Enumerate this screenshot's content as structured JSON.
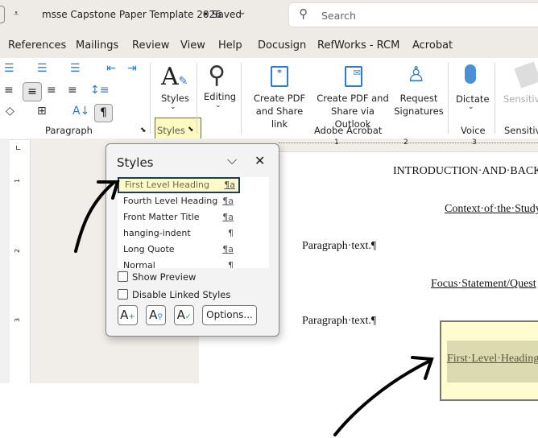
{
  "titlebar": {
    "customize_icon": "quick-access-dropdown",
    "document_title": "msse Capstone Paper  Template 2026",
    "status": "• Saved",
    "search_placeholder": "Search"
  },
  "tabs": [
    "References",
    "Mailings",
    "Review",
    "View",
    "Help",
    "Docusign",
    "RefWorks - RCM",
    "Acrobat"
  ],
  "ribbon": {
    "paragraph_group": "Paragraph",
    "styles_button": "Styles",
    "styles_group": "Styles",
    "editing_button": "Editing",
    "acrobat": {
      "create_share_link": [
        "Create PDF",
        "and Share link"
      ],
      "create_outlook": [
        "Create PDF and",
        "Share via Outlook"
      ],
      "request_signatures": [
        "Request",
        "Signatures"
      ],
      "group": "Adobe Acrobat"
    },
    "voice": {
      "dictate": "Dictate",
      "group": "Voice"
    },
    "sensitivity": {
      "button": "Sensitivi",
      "group": "Sensitivi"
    }
  },
  "styles_pane": {
    "title": "Styles",
    "items": [
      {
        "name": "First Level Heading",
        "mark": "¶a",
        "selected": true
      },
      {
        "name": "Fourth Level Heading",
        "mark": "¶a"
      },
      {
        "name": "Front Matter Title",
        "mark": "¶a"
      },
      {
        "name": "hanging-indent",
        "mark": "¶"
      },
      {
        "name": "Long Quote",
        "mark": "¶a"
      },
      {
        "name": "Normal",
        "mark": "¶"
      }
    ],
    "show_preview": "Show Preview",
    "show_preview_checked": false,
    "disable_linked": "Disable Linked Styles",
    "disable_linked_checked": false,
    "options": "Options..."
  },
  "ruler": {
    "h": [
      "1",
      "2",
      "3"
    ],
    "v": [
      "1",
      "2",
      "3"
    ]
  },
  "document": {
    "heading": "INTRODUCTION·AND·BACK",
    "sub1": "Context·of·the·Study",
    "para1": "Paragraph·text.¶",
    "sub2": "Focus·Statement/Quest",
    "para2": "Paragraph·text.¶",
    "callout": "First·Level·Heading"
  },
  "colors": {
    "highlight": "#fffbc8",
    "accent": "#2b7cd3"
  }
}
